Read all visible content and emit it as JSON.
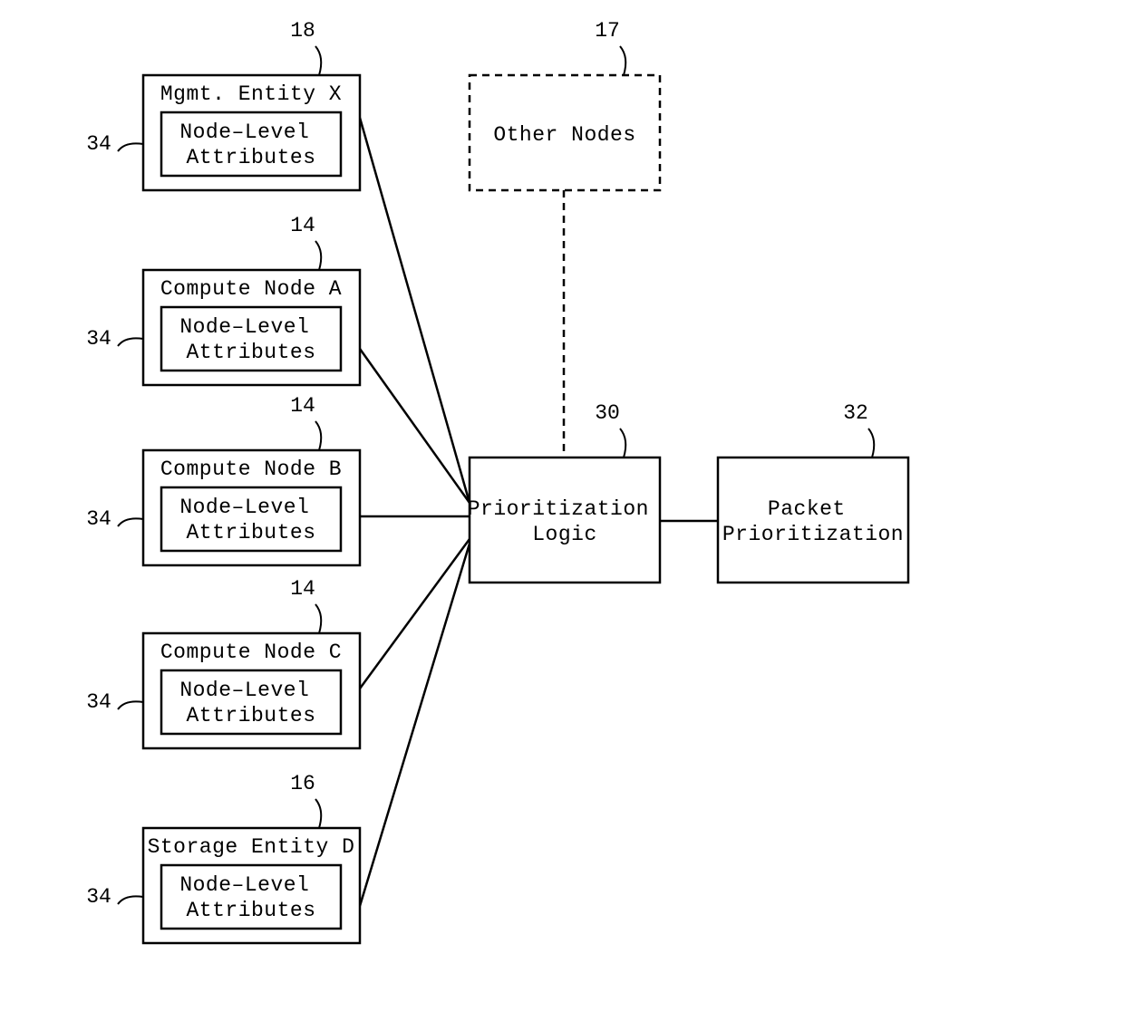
{
  "nodes": {
    "mgmt": {
      "title": "Mgmt. Entity X",
      "attr": "Node–Level\nAttributes",
      "ref": "18",
      "leftRef": "34"
    },
    "compA": {
      "title": "Compute Node A",
      "attr": "Node–Level\nAttributes",
      "ref": "14",
      "leftRef": "34"
    },
    "compB": {
      "title": "Compute Node B",
      "attr": "Node–Level\nAttributes",
      "ref": "14",
      "leftRef": "34"
    },
    "compC": {
      "title": "Compute Node C",
      "attr": "Node–Level\nAttributes",
      "ref": "14",
      "leftRef": "34"
    },
    "storD": {
      "title": "Storage Entity D",
      "attr": "Node–Level\nAttributes",
      "ref": "16",
      "leftRef": "34"
    }
  },
  "other": {
    "title": "Other Nodes",
    "ref": "17"
  },
  "prio": {
    "title": "Prioritization\nLogic",
    "ref": "30"
  },
  "packet": {
    "title": "Packet\nPrioritization",
    "ref": "32"
  }
}
